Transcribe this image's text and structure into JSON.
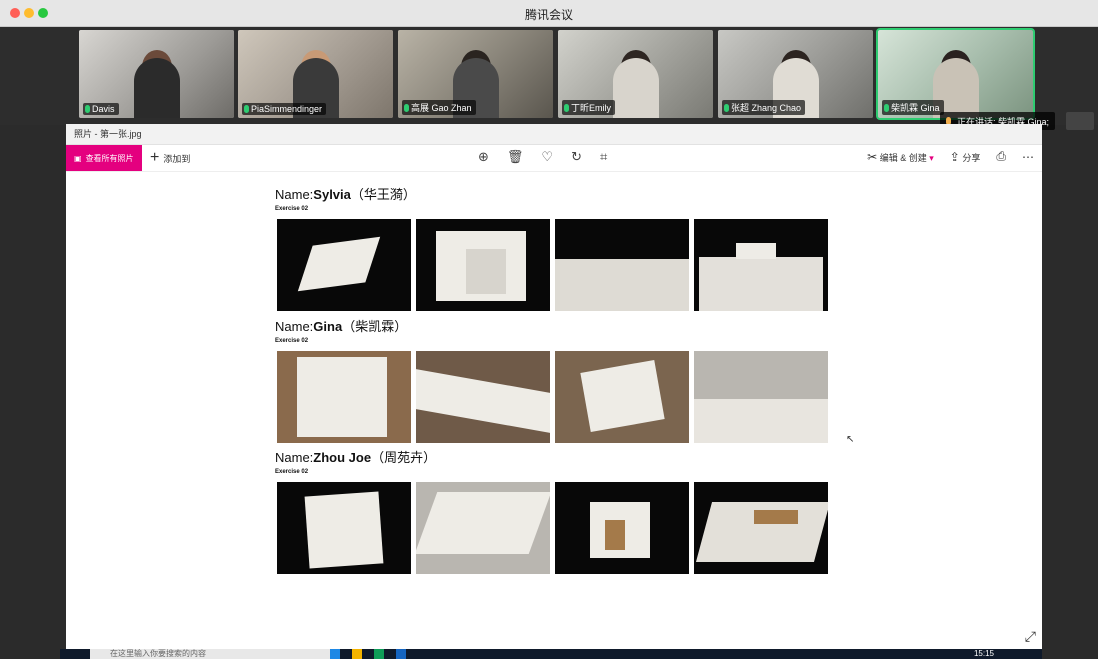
{
  "app": {
    "window_title": "腾讯会议"
  },
  "participants": [
    {
      "name": "Davis",
      "active": false
    },
    {
      "name": "PiaSimmendinger",
      "active": false
    },
    {
      "name": "高展 Gao Zhan",
      "active": false
    },
    {
      "name": "丁昕Emily",
      "active": false
    },
    {
      "name": "张超 Zhang Chao",
      "active": false
    },
    {
      "name": "柴凯霖 Gina",
      "active": true
    }
  ],
  "speaking": {
    "label": "正在讲话: 柴凯霖 Gina;"
  },
  "photos": {
    "title": "照片 - 第一张.jpg",
    "view_all": "查看所有照片",
    "add_to": "添加到",
    "edit_create": "编辑 & 创建",
    "share": "分享"
  },
  "document": {
    "sections": [
      {
        "name_prefix": "Name:",
        "name": "Sylvia",
        "cn": "（华王漪）",
        "exercise": "Exercise 02"
      },
      {
        "name_prefix": "Name:",
        "name": "Gina",
        "cn": "（柴凯霖）",
        "exercise": "Exercise 02"
      },
      {
        "name_prefix": "Name:",
        "name": "Zhou Joe",
        "cn": "（周苑卉）",
        "exercise": "Exercise 02"
      }
    ]
  },
  "taskbar": {
    "search_placeholder": "在这里输入你要搜索的内容",
    "time": "15:15"
  },
  "colors": {
    "accent": "#e4007f",
    "active_speaker": "#2ecc71"
  }
}
